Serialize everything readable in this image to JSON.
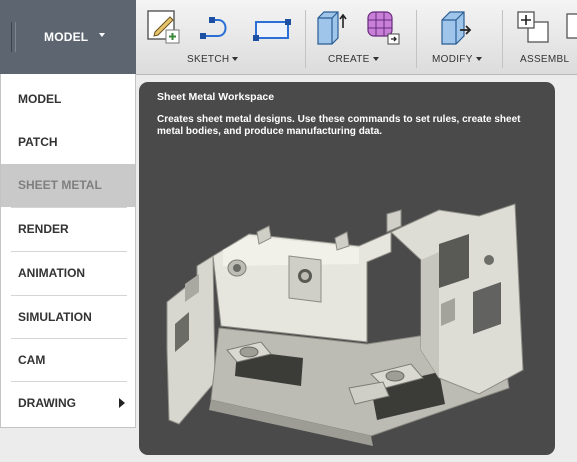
{
  "toolbar": {
    "workspace_label": "MODEL",
    "groups": [
      {
        "label": "SKETCH"
      },
      {
        "label": "CREATE"
      },
      {
        "label": "MODIFY"
      },
      {
        "label": "ASSEMBL"
      }
    ],
    "tools": [
      {
        "icon": "create-sketch-icon"
      },
      {
        "icon": "sketch-line-icon"
      },
      {
        "icon": "rectangle-icon"
      },
      {
        "icon": "extrude-icon"
      },
      {
        "icon": "form-icon"
      },
      {
        "icon": "press-pull-icon"
      },
      {
        "icon": "new-component-icon"
      }
    ]
  },
  "workspace_menu": {
    "items": [
      {
        "label": "MODEL"
      },
      {
        "label": "PATCH"
      },
      {
        "label": "SHEET METAL",
        "selected": true
      },
      {
        "label": "RENDER"
      },
      {
        "label": "ANIMATION"
      },
      {
        "label": "SIMULATION"
      },
      {
        "label": "CAM"
      },
      {
        "label": "DRAWING",
        "has_submenu": true
      }
    ]
  },
  "tooltip": {
    "title": "Sheet Metal Workspace",
    "description": "Creates sheet metal designs. Use these commands to set rules, create sheet metal bodies, and produce manufacturing data."
  },
  "colors": {
    "workspace_button": "#5d6670",
    "tooltip_bg": "#4a4a4a",
    "selected_item": "#c9c9c9"
  }
}
